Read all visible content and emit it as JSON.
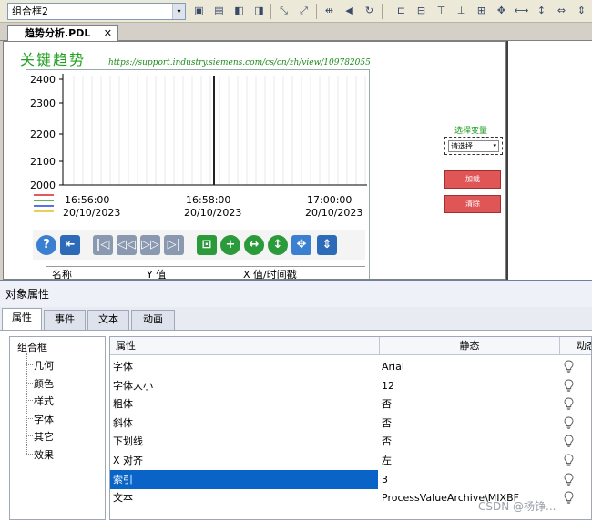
{
  "toolbar": {
    "combo_value": "组合框2",
    "combo_arrow": "▾"
  },
  "tab": {
    "label": "趋势分析.PDL",
    "close": "✕"
  },
  "canvas": {
    "title": "关键趋势",
    "url": "https://support.industry.siemens.com/cs/cn/zh/view/109782055",
    "select_label": "选择变量",
    "select_value": "请选择...",
    "load_button": "加载",
    "clear_button": "清除"
  },
  "trend": {
    "y_ticks": [
      "2400",
      "2300",
      "2200",
      "2100",
      "2000"
    ],
    "x_ticks": [
      {
        "time": "16:56:00",
        "date": "20/10/2023"
      },
      {
        "time": "16:58:00",
        "date": "20/10/2023"
      },
      {
        "time": "17:00:00",
        "date": "20/10/2023"
      }
    ],
    "columns": [
      "名称",
      "Y 值",
      "X 值/时间戳"
    ],
    "legend_colors": [
      "#e02020",
      "#20a020",
      "#2040e0",
      "#e0c020"
    ]
  },
  "props": {
    "title": "对象属性",
    "tabs": [
      "属性",
      "事件",
      "文本",
      "动画"
    ],
    "tree_root": "组合框",
    "tree_items": [
      "几何",
      "颜色",
      "样式",
      "字体",
      "其它",
      "效果"
    ],
    "grid_headers": [
      "属性",
      "静态",
      "动态"
    ],
    "rows": [
      {
        "name": "字体",
        "value": "Arial"
      },
      {
        "name": "字体大小",
        "value": "12"
      },
      {
        "name": "粗体",
        "value": "否"
      },
      {
        "name": "斜体",
        "value": "否"
      },
      {
        "name": "下划线",
        "value": "否"
      },
      {
        "name": "X 对齐",
        "value": "左"
      },
      {
        "name": "索引",
        "value": "3"
      },
      {
        "name": "文本",
        "value": "ProcessValueArchive\\MIXBF"
      }
    ]
  },
  "watermark": "CSDN @杨铮..."
}
